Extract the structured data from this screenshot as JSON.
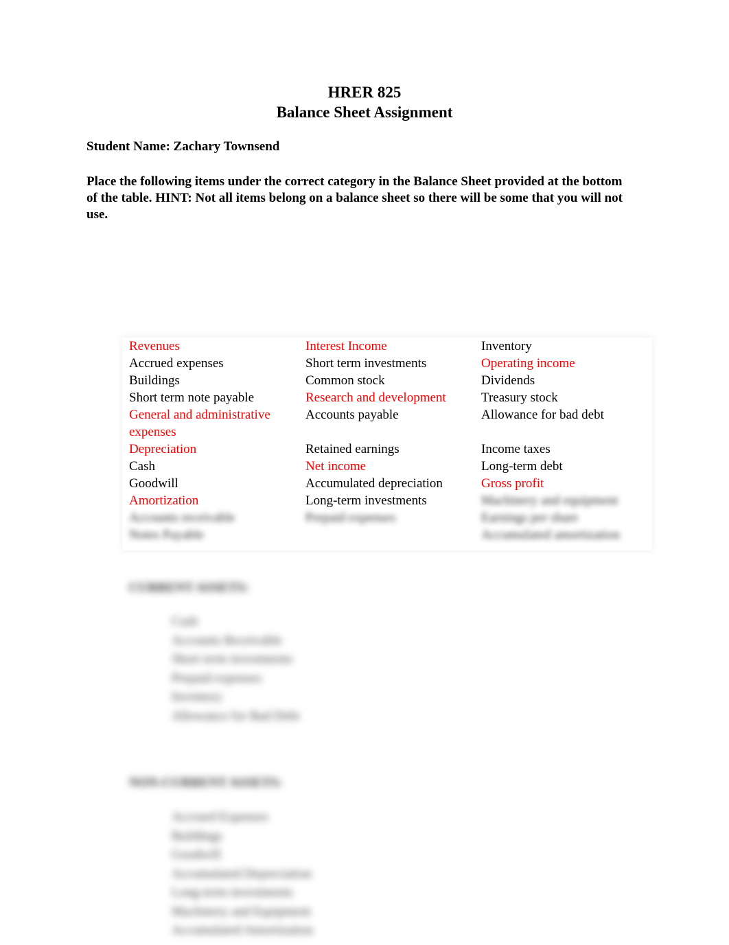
{
  "header": {
    "course": "HRER 825",
    "title": "Balance Sheet Assignment"
  },
  "student": {
    "label": "Student Name: Zachary Townsend"
  },
  "instructions": "Place the following items under the correct category in the Balance Sheet provided at the bottom of the table. HINT: Not all items belong on a balance sheet so there will be some that you will not use.",
  "colors": {
    "highlight": "#ff0000",
    "text": "#000000"
  },
  "table": {
    "rows": [
      [
        {
          "text": "Revenues",
          "red": true
        },
        {
          "text": "Interest Income",
          "red": true
        },
        {
          "text": "Inventory",
          "red": false
        }
      ],
      [
        {
          "text": "Accrued expenses",
          "red": false
        },
        {
          "text": "Short term investments",
          "red": false
        },
        {
          "text": "Operating income",
          "red": true
        }
      ],
      [
        {
          "text": "Buildings",
          "red": false
        },
        {
          "text": "Common stock",
          "red": false
        },
        {
          "text": "Dividends",
          "red": false
        }
      ],
      [
        {
          "text": "Short term note payable",
          "red": false
        },
        {
          "text": "Research and development",
          "red": true
        },
        {
          "text": "Treasury stock",
          "red": false
        }
      ],
      [
        {
          "text": "General and administrative expenses",
          "red": true
        },
        {
          "text": "Accounts payable",
          "red": false
        },
        {
          "text": "Allowance for bad debt",
          "red": false
        }
      ],
      [
        {
          "text": "Depreciation",
          "red": true
        },
        {
          "text": "Retained earnings",
          "red": false
        },
        {
          "text": "Income taxes",
          "red": false
        }
      ],
      [
        {
          "text": "Cash",
          "red": false
        },
        {
          "text": "Net income",
          "red": true
        },
        {
          "text": "Long-term debt",
          "red": false
        }
      ],
      [
        {
          "text": "Goodwill",
          "red": false
        },
        {
          "text": "Accumulated depreciation",
          "red": false
        },
        {
          "text": "Gross profit",
          "red": true
        }
      ],
      [
        {
          "text": "Amortization",
          "red": true
        },
        {
          "text": "Long-term investments",
          "red": false
        },
        {
          "text": "Machinery and equipment",
          "red": false,
          "blurred": true
        }
      ],
      [
        {
          "text": "Accounts receivable",
          "red": false,
          "blurred": true
        },
        {
          "text": "Prepaid expenses",
          "red": false,
          "blurred": true
        },
        {
          "text": "Earnings per share",
          "red": true,
          "blurred": true
        }
      ],
      [
        {
          "text": "Notes Payable",
          "red": false,
          "blurred": true
        },
        {
          "text": "",
          "red": false,
          "blurred": true
        },
        {
          "text": "Accumulated amortization",
          "red": false,
          "blurred": true
        }
      ]
    ]
  },
  "sections": [
    {
      "heading": "CURRENT ASSETS:",
      "items": [
        "Cash",
        "Accounts Receivable",
        "Short term investments",
        "Prepaid expenses",
        "Inventory",
        "Allowance for Bad Debt"
      ]
    },
    {
      "heading": "NON-CURRENT ASSETS:",
      "items": [
        "Accrued Expenses",
        "Buildings",
        "Goodwill",
        "Accumulated Depreciation",
        "Long-term investments",
        "Machinery and Equipment",
        "Accumulated Amortization"
      ]
    }
  ]
}
